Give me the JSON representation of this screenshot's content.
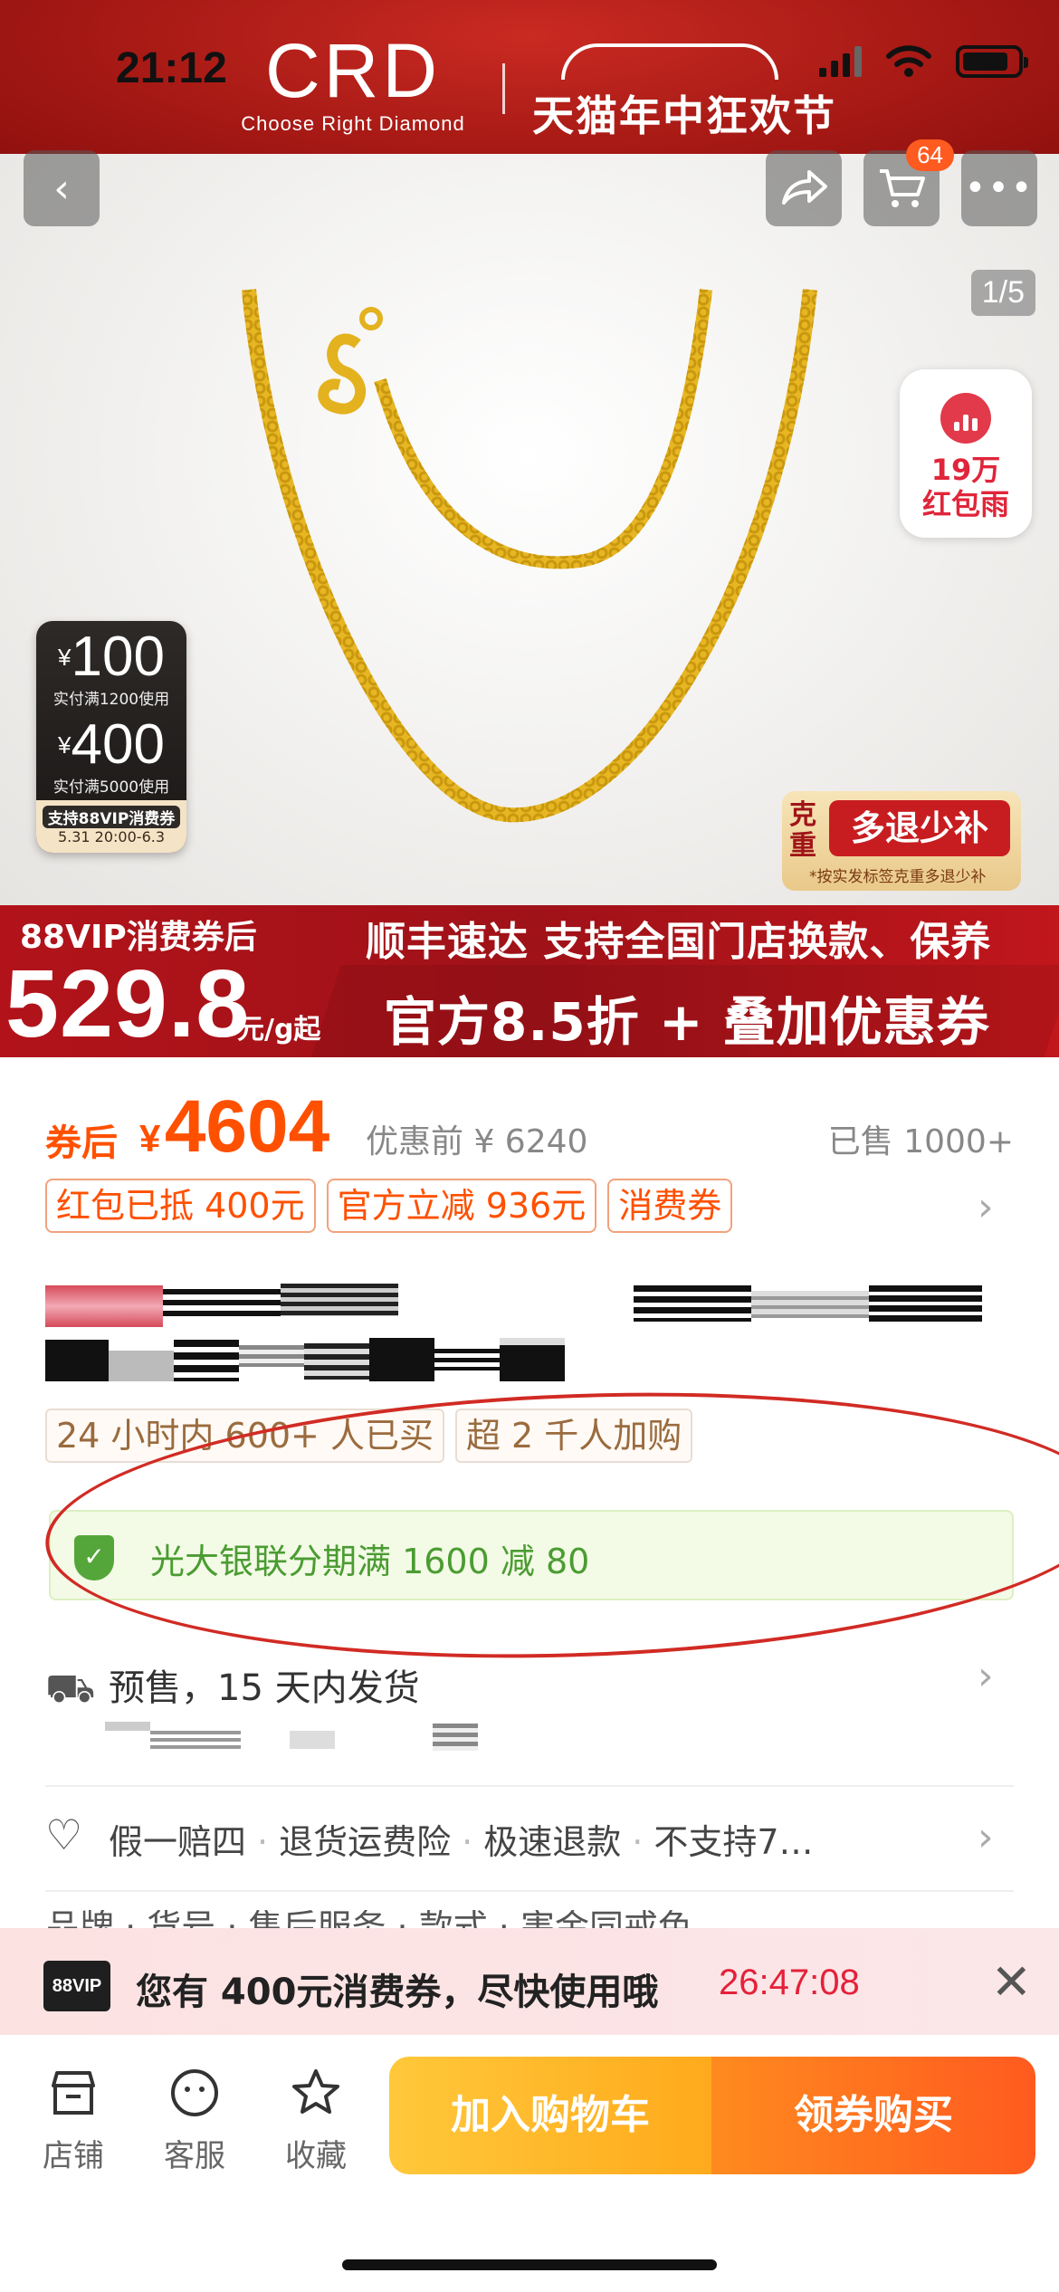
{
  "status_bar": {
    "time": "21:12"
  },
  "brand": {
    "logo_text": "CRD",
    "logo_tagline": "Choose Right Diamond",
    "festival": "天猫年中狂欢节"
  },
  "nav": {
    "back_icon": "chevron-left-icon",
    "share_icon": "share-icon",
    "cart_icon": "cart-icon",
    "cart_badge": "64",
    "more_icon": "more-icon"
  },
  "gallery": {
    "page_indicator": "1/5"
  },
  "red_packet": {
    "line1": "19万",
    "line2": "红包雨"
  },
  "coupon_tag": {
    "coupon1_currency": "¥",
    "coupon1_amount": "100",
    "coupon1_condition": "实付满1200使用",
    "coupon2_currency": "¥",
    "coupon2_amount": "400",
    "coupon2_condition": "实付满5000使用",
    "support_text": "支持88VIP消费券",
    "date_range": "5.31 20:00-6.3"
  },
  "refund_tag": {
    "side_label": "克重",
    "main_label": "多退少补",
    "note": "*按实发标签克重多退少补"
  },
  "price_band": {
    "label": "88VIP消费券后",
    "price": "529.8",
    "unit": "元/g起",
    "line1": "顺丰速达 支持全国门店换款、保养",
    "line2": "官方8.5折 + 叠加优惠券"
  },
  "pricing": {
    "after_label": "券后",
    "currency": "¥",
    "after_price": "4604",
    "before_price": "优惠前 ¥ 6240",
    "sold": "已售 1000+"
  },
  "promo_tags": [
    "红包已抵 400元",
    "官方立减 936元",
    "消费券"
  ],
  "stats": [
    "24 小时内 600+ 人已买",
    "超 2 千人加购"
  ],
  "bank_offer": {
    "text": "光大银联分期满 1600 减 80"
  },
  "shipping": {
    "text": "预售，15 天内发货"
  },
  "guarantees": [
    "假一赔四",
    "退货运费险",
    "极速退款",
    "不支持7…"
  ],
  "partial_row": "品牌 · 货号 · 售后服务 · 款式 · 害金同戒色",
  "vip_banner": {
    "badge": "88VIP",
    "message": "您有 400元消费券，尽快使用哦",
    "timer": "26:47:08"
  },
  "bottom_bar": {
    "shop_label": "店铺",
    "service_label": "客服",
    "favorite_label": "收藏",
    "add_to_cart": "加入购物车",
    "buy": "领券购买"
  }
}
